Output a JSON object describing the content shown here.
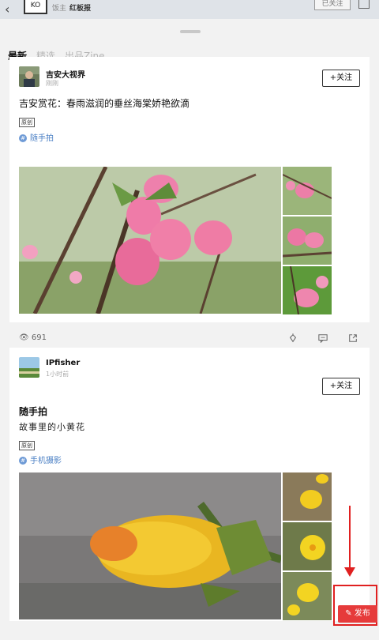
{
  "header": {
    "creator_label": "饭主",
    "creator_name": "红板报",
    "follow_status": "已关注",
    "avatar_text": "KO"
  },
  "tabs": [
    {
      "label": "最新",
      "active": true
    },
    {
      "label": "精选",
      "active": false
    },
    {
      "label": "出品Zine",
      "active": false
    }
  ],
  "posts": [
    {
      "author": "吉安大视界",
      "time": "刚刚",
      "follow_label": "+关注",
      "title": "吉安赏花：春雨滋润的垂丝海棠娇艳欲滴",
      "tag": "原创",
      "topic": "随手拍",
      "views": "691"
    },
    {
      "author": "IPfisher",
      "time": "1小时前",
      "follow_label": "+关注",
      "title": "随手拍",
      "subtitle": "故事里的小黄花",
      "tag": "原创",
      "topic": "手机摄影"
    }
  ],
  "publish": {
    "label": "发布"
  },
  "colors": {
    "accent_red": "#e63b3b",
    "link_blue": "#4a7fc4"
  }
}
